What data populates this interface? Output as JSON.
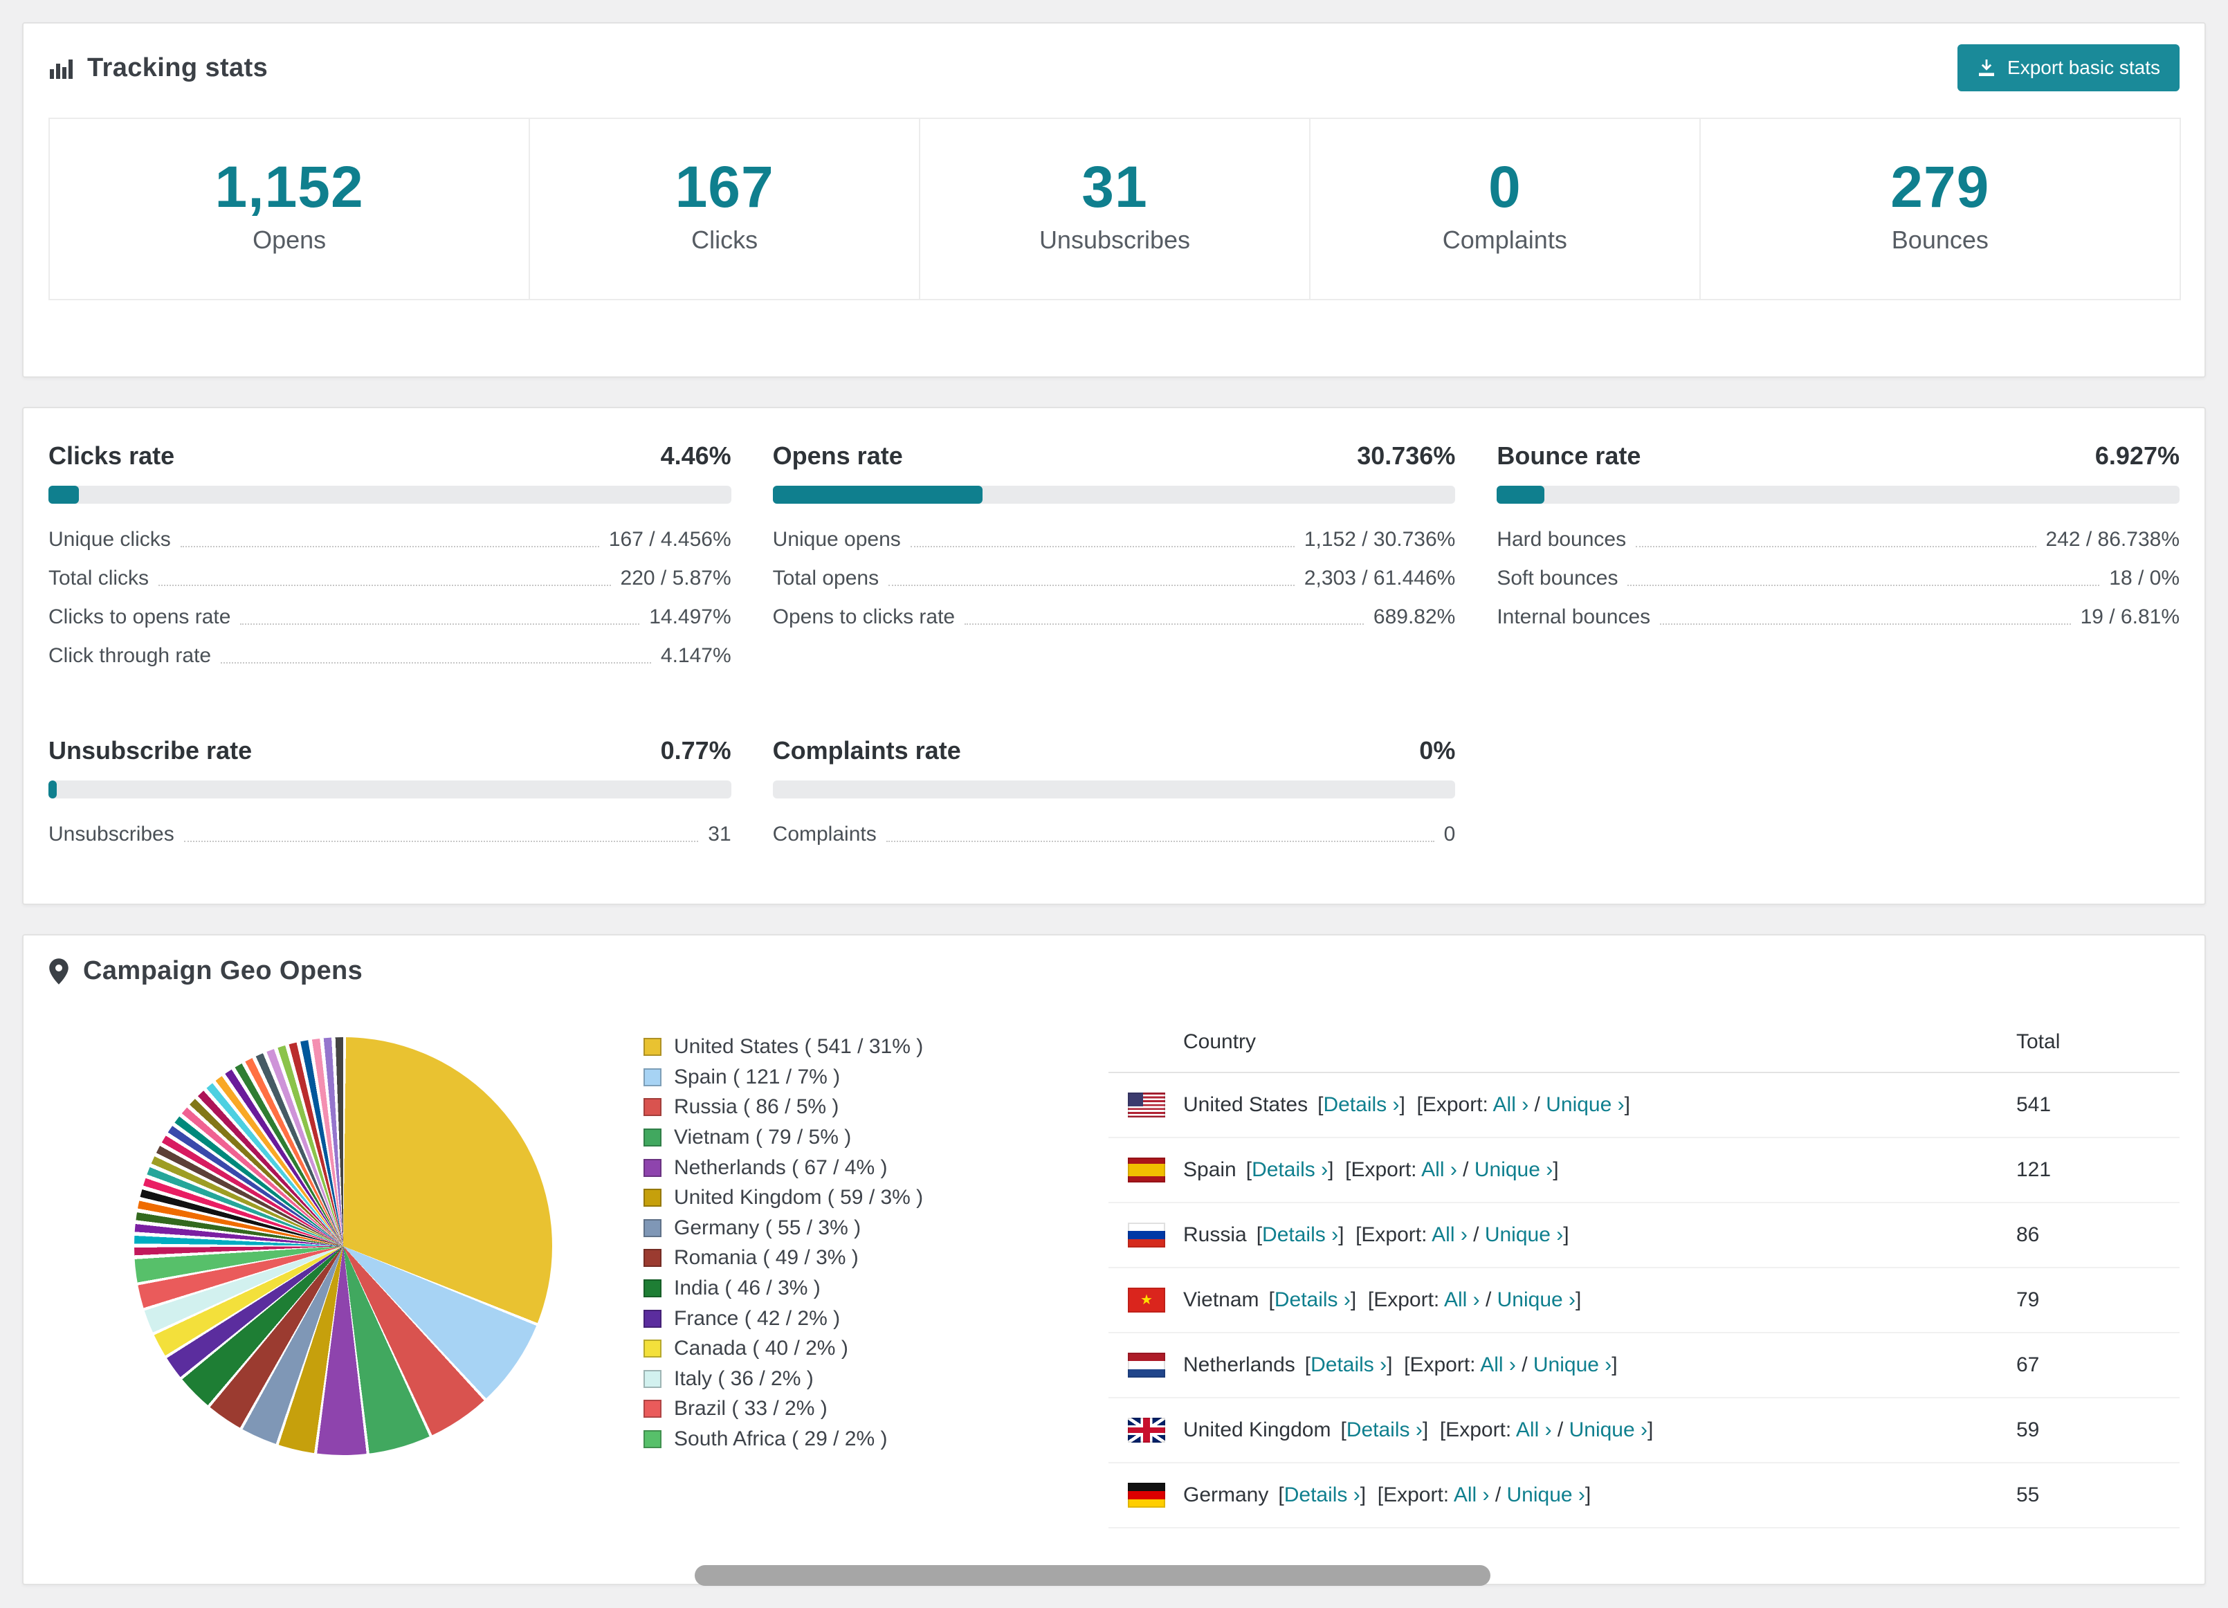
{
  "colors": {
    "accent": "#0f7f8e",
    "button_teal": "#1a8a99"
  },
  "tracking": {
    "title": "Tracking stats",
    "export_button": "Export basic stats",
    "stats": [
      {
        "value": "1,152",
        "label": "Opens"
      },
      {
        "value": "167",
        "label": "Clicks"
      },
      {
        "value": "31",
        "label": "Unsubscribes"
      },
      {
        "value": "0",
        "label": "Complaints"
      },
      {
        "value": "279",
        "label": "Bounces"
      }
    ]
  },
  "rates": [
    {
      "title": "Clicks rate",
      "percent_label": "4.46%",
      "percent": 4.46,
      "rows": [
        {
          "label": "Unique clicks",
          "value": "167 / 4.456%"
        },
        {
          "label": "Total clicks",
          "value": "220 / 5.87%"
        },
        {
          "label": "Clicks to opens rate",
          "value": "14.497%"
        },
        {
          "label": "Click through rate",
          "value": "4.147%"
        }
      ]
    },
    {
      "title": "Opens rate",
      "percent_label": "30.736%",
      "percent": 30.736,
      "rows": [
        {
          "label": "Unique opens",
          "value": "1,152 / 30.736%"
        },
        {
          "label": "Total opens",
          "value": "2,303 / 61.446%"
        },
        {
          "label": "Opens to clicks rate",
          "value": "689.82%"
        }
      ]
    },
    {
      "title": "Bounce rate",
      "percent_label": "6.927%",
      "percent": 6.927,
      "rows": [
        {
          "label": "Hard bounces",
          "value": "242 / 86.738%"
        },
        {
          "label": "Soft bounces",
          "value": "18 / 0%"
        },
        {
          "label": "Internal bounces",
          "value": "19 / 6.81%"
        }
      ]
    },
    {
      "title": "Unsubscribe rate",
      "percent_label": "0.77%",
      "percent": 0.77,
      "rows": [
        {
          "label": "Unsubscribes",
          "value": "31"
        }
      ]
    },
    {
      "title": "Complaints rate",
      "percent_label": "0%",
      "percent": 0,
      "rows": [
        {
          "label": "Complaints",
          "value": "0"
        }
      ]
    }
  ],
  "geo": {
    "title": "Campaign Geo Opens",
    "chart_data": {
      "type": "pie",
      "title": "Campaign Geo Opens",
      "legend_position": "right",
      "slices": [
        {
          "label": "United States",
          "count": 541,
          "percent": 31,
          "color": "#e9c231"
        },
        {
          "label": "Spain",
          "count": 121,
          "percent": 7,
          "color": "#a7d3f4"
        },
        {
          "label": "Russia",
          "count": 86,
          "percent": 5,
          "color": "#d9534f"
        },
        {
          "label": "Vietnam",
          "count": 79,
          "percent": 5,
          "color": "#41a85f"
        },
        {
          "label": "Netherlands",
          "count": 67,
          "percent": 4,
          "color": "#8e44ad"
        },
        {
          "label": "United Kingdom",
          "count": 59,
          "percent": 3,
          "color": "#c6a00c"
        },
        {
          "label": "Germany",
          "count": 55,
          "percent": 3,
          "color": "#7f97b6"
        },
        {
          "label": "Romania",
          "count": 49,
          "percent": 3,
          "color": "#9b3b30"
        },
        {
          "label": "India",
          "count": 46,
          "percent": 3,
          "color": "#1e7e34"
        },
        {
          "label": "France",
          "count": 42,
          "percent": 2,
          "color": "#5b2d9e"
        },
        {
          "label": "Canada",
          "count": 40,
          "percent": 2,
          "color": "#f3e03b"
        },
        {
          "label": "Italy",
          "count": 36,
          "percent": 2,
          "color": "#d2f1ef"
        },
        {
          "label": "Brazil",
          "count": 33,
          "percent": 2,
          "color": "#ea5b5b"
        },
        {
          "label": "South Africa",
          "count": 29,
          "percent": 2,
          "color": "#57c06a"
        }
      ],
      "others_percent": 26,
      "others_colors": [
        "#c2185b",
        "#00acc1",
        "#7b1fa2",
        "#33691e",
        "#ef6c00",
        "#111111",
        "#e91e63",
        "#26a69a",
        "#9e9d24",
        "#5d4037",
        "#d81b60",
        "#3949ab",
        "#00897b",
        "#f06292",
        "#827717",
        "#ad1457",
        "#4dd0e1",
        "#f9a825",
        "#6a1b9a",
        "#2e7d32",
        "#ff7043",
        "#455a64",
        "#ce93d8",
        "#8bc34a",
        "#ba2d2d",
        "#01579b",
        "#f48fb1",
        "#9575cd",
        "#444444"
      ]
    },
    "table": {
      "headers": [
        "Country",
        "Total"
      ],
      "details_label": "Details ›",
      "export_label": "Export:",
      "all_label": "All ›",
      "unique_label": "Unique ›",
      "rows": [
        {
          "country": "United States",
          "flag": "us",
          "total": "541"
        },
        {
          "country": "Spain",
          "flag": "es",
          "total": "121"
        },
        {
          "country": "Russia",
          "flag": "ru",
          "total": "86"
        },
        {
          "country": "Vietnam",
          "flag": "vn",
          "total": "79"
        },
        {
          "country": "Netherlands",
          "flag": "nl",
          "total": "67"
        },
        {
          "country": "United Kingdom",
          "flag": "gb",
          "total": "59"
        },
        {
          "country": "Germany",
          "flag": "de",
          "total": "55"
        }
      ]
    }
  }
}
